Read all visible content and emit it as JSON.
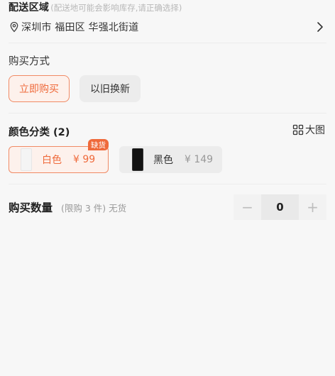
{
  "delivery": {
    "title": "配送区域",
    "hint": "(配送地可能会影响库存,请正确选择)",
    "address": "深圳市 福田区 华强北街道"
  },
  "purchase_method": {
    "title": "购买方式",
    "options": [
      "立即购买",
      "以旧换新"
    ],
    "selected": "立即购买"
  },
  "color": {
    "title": "颜色分类 (2)",
    "big_image_label": "大图",
    "options": [
      {
        "name": "白色",
        "price": "¥ 99",
        "badge": "缺货",
        "selected": true
      },
      {
        "name": "黑色",
        "price": "¥ 149",
        "selected": false
      }
    ]
  },
  "quantity": {
    "title": "购买数量",
    "note": "(限购 3 件) 无货",
    "minus": "−",
    "value": "0",
    "plus": "+"
  },
  "colors": {
    "accent": "#ef6a3b",
    "accent_bg": "#fdf1ec",
    "page_bg": "#f7f7f7"
  }
}
